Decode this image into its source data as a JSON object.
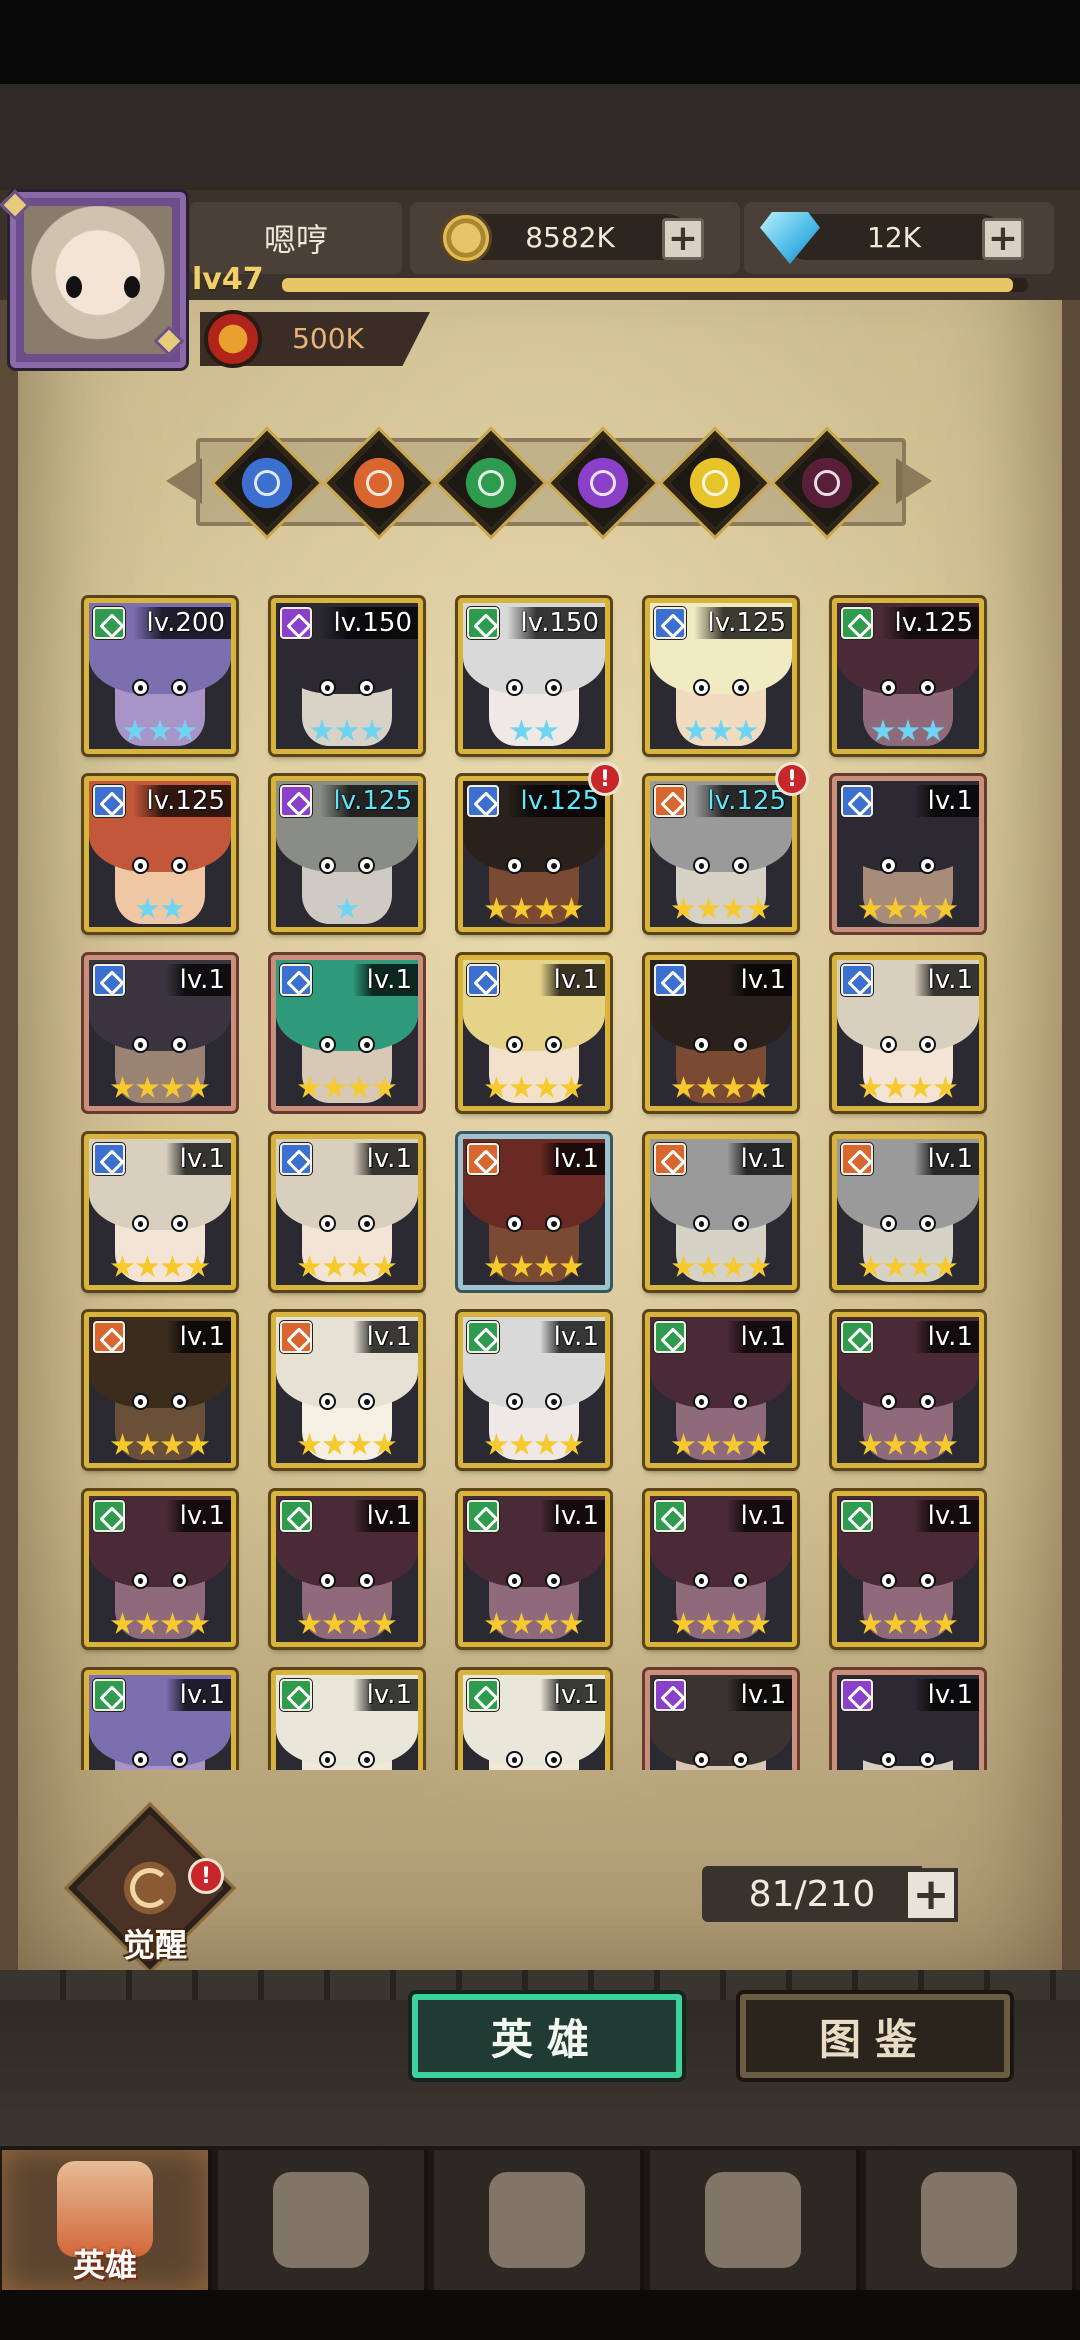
{
  "header": {
    "player_name": "嗯哼",
    "level": "lv47",
    "xp_fraction": 0.98,
    "gold": "8582K",
    "gems": "12K",
    "power": "500K"
  },
  "factions": [
    {
      "name": "faction-light",
      "color": "#3b6fd0"
    },
    {
      "name": "faction-fire",
      "color": "#d8662e"
    },
    {
      "name": "faction-nature",
      "color": "#2f9b4f"
    },
    {
      "name": "faction-arcane",
      "color": "#8a40c8"
    },
    {
      "name": "faction-holy",
      "color": "#e7c42a"
    },
    {
      "name": "faction-dark",
      "color": "#5a1f38"
    }
  ],
  "heroes": [
    {
      "level": "lv.200",
      "class_color": "#2f9b4f",
      "stars": 3,
      "star_color": "blue",
      "hair": "#7b6fb0",
      "skin": "#a994c7",
      "frame": "gold",
      "cyan": false,
      "alert": false
    },
    {
      "level": "lv.150",
      "class_color": "#8a40c8",
      "stars": 3,
      "star_color": "blue",
      "hair": "#2c2933",
      "skin": "#d9d2c6",
      "frame": "gold",
      "cyan": false,
      "alert": false
    },
    {
      "level": "lv.150",
      "class_color": "#2f9b4f",
      "stars": 2,
      "star_color": "blue",
      "hair": "#d9d9d9",
      "skin": "#efe8e4",
      "frame": "gold",
      "cyan": false,
      "alert": false
    },
    {
      "level": "lv.125",
      "class_color": "#3b6fd0",
      "stars": 3,
      "star_color": "blue",
      "hair": "#f1ebc4",
      "skin": "#f1dcc0",
      "frame": "gold",
      "cyan": false,
      "alert": false
    },
    {
      "level": "lv.125",
      "class_color": "#2f9b4f",
      "stars": 3,
      "star_color": "blue",
      "hair": "#4a2a36",
      "skin": "#8e6a7a",
      "frame": "gold",
      "cyan": false,
      "alert": false
    },
    {
      "level": "lv.125",
      "class_color": "#3b6fd0",
      "stars": 2,
      "star_color": "blue",
      "hair": "#c2573a",
      "skin": "#f0c8a6",
      "frame": "gold",
      "cyan": false,
      "alert": false
    },
    {
      "level": "lv.125",
      "class_color": "#8a40c8",
      "stars": 1,
      "star_color": "blue",
      "hair": "#8a8c86",
      "skin": "#cfcbc4",
      "frame": "gold",
      "cyan": true,
      "alert": false
    },
    {
      "level": "lv.125",
      "class_color": "#3b6fd0",
      "stars": 4,
      "star_color": "gold",
      "hair": "#2a211d",
      "skin": "#7a4a32",
      "frame": "gold",
      "cyan": true,
      "alert": true
    },
    {
      "level": "lv.125",
      "class_color": "#d8662e",
      "stars": 4,
      "star_color": "gold",
      "hair": "#9a9a9a",
      "skin": "#d7d2c6",
      "frame": "gold",
      "cyan": true,
      "alert": true
    },
    {
      "level": "lv.1",
      "class_color": "#3b6fd0",
      "stars": 4,
      "star_color": "gold",
      "hair": "#2c2933",
      "skin": "#a78c7a",
      "frame": "pink",
      "cyan": false,
      "alert": false
    },
    {
      "level": "lv.1",
      "class_color": "#3b6fd0",
      "stars": 4,
      "star_color": "gold",
      "hair": "#3a3440",
      "skin": "#9b8374",
      "frame": "pink",
      "cyan": false,
      "alert": false
    },
    {
      "level": "lv.1",
      "class_color": "#3b6fd0",
      "stars": 4,
      "star_color": "gold",
      "hair": "#2f9b7a",
      "skin": "#d7c9b5",
      "frame": "pink",
      "cyan": false,
      "alert": false
    },
    {
      "level": "lv.1",
      "class_color": "#3b6fd0",
      "stars": 4,
      "star_color": "gold",
      "hair": "#e6d38a",
      "skin": "#f2e1cb",
      "frame": "gold",
      "cyan": false,
      "alert": false
    },
    {
      "level": "lv.1",
      "class_color": "#3b6fd0",
      "stars": 4,
      "star_color": "gold",
      "hair": "#2a211d",
      "skin": "#7a4a32",
      "frame": "gold",
      "cyan": false,
      "alert": false
    },
    {
      "level": "lv.1",
      "class_color": "#3b6fd0",
      "stars": 4,
      "star_color": "gold",
      "hair": "#d8cfbe",
      "skin": "#f3e4d6",
      "frame": "gold",
      "cyan": false,
      "alert": false
    },
    {
      "level": "lv.1",
      "class_color": "#3b6fd0",
      "stars": 4,
      "star_color": "gold",
      "hair": "#d8cfbe",
      "skin": "#f3e4d6",
      "frame": "gold",
      "cyan": false,
      "alert": false
    },
    {
      "level": "lv.1",
      "class_color": "#3b6fd0",
      "stars": 4,
      "star_color": "gold",
      "hair": "#d8cfbe",
      "skin": "#f3e4d6",
      "frame": "gold",
      "cyan": false,
      "alert": false
    },
    {
      "level": "lv.1",
      "class_color": "#d8662e",
      "stars": 4,
      "star_color": "gold",
      "hair": "#6a2a24",
      "skin": "#7a4a32",
      "frame": "silver",
      "cyan": false,
      "alert": false
    },
    {
      "level": "lv.1",
      "class_color": "#d8662e",
      "stars": 4,
      "star_color": "gold",
      "hair": "#9a9a9a",
      "skin": "#d7d2c6",
      "frame": "gold",
      "cyan": false,
      "alert": false
    },
    {
      "level": "lv.1",
      "class_color": "#d8662e",
      "stars": 4,
      "star_color": "gold",
      "hair": "#9a9a9a",
      "skin": "#d7d2c6",
      "frame": "gold",
      "cyan": false,
      "alert": false
    },
    {
      "level": "lv.1",
      "class_color": "#d8662e",
      "stars": 4,
      "star_color": "gold",
      "hair": "#3b2c1e",
      "skin": "#6a5038",
      "frame": "gold",
      "cyan": false,
      "alert": false
    },
    {
      "level": "lv.1",
      "class_color": "#d8662e",
      "stars": 4,
      "star_color": "gold",
      "hair": "#e7e1d4",
      "skin": "#f5efe4",
      "frame": "gold",
      "cyan": false,
      "alert": false
    },
    {
      "level": "lv.1",
      "class_color": "#2f9b4f",
      "stars": 4,
      "star_color": "gold",
      "hair": "#d9d9d9",
      "skin": "#efe8e4",
      "frame": "gold",
      "cyan": false,
      "alert": false
    },
    {
      "level": "lv.1",
      "class_color": "#2f9b4f",
      "stars": 4,
      "star_color": "gold",
      "hair": "#4a2a36",
      "skin": "#8e6a7a",
      "frame": "gold",
      "cyan": false,
      "alert": false
    },
    {
      "level": "lv.1",
      "class_color": "#2f9b4f",
      "stars": 4,
      "star_color": "gold",
      "hair": "#4a2a36",
      "skin": "#8e6a7a",
      "frame": "gold",
      "cyan": false,
      "alert": false
    },
    {
      "level": "lv.1",
      "class_color": "#2f9b4f",
      "stars": 4,
      "star_color": "gold",
      "hair": "#4a2a36",
      "skin": "#8e6a7a",
      "frame": "gold",
      "cyan": false,
      "alert": false
    },
    {
      "level": "lv.1",
      "class_color": "#2f9b4f",
      "stars": 4,
      "star_color": "gold",
      "hair": "#4a2a36",
      "skin": "#8e6a7a",
      "frame": "gold",
      "cyan": false,
      "alert": false
    },
    {
      "level": "lv.1",
      "class_color": "#2f9b4f",
      "stars": 4,
      "star_color": "gold",
      "hair": "#4a2a36",
      "skin": "#8e6a7a",
      "frame": "gold",
      "cyan": false,
      "alert": false
    },
    {
      "level": "lv.1",
      "class_color": "#2f9b4f",
      "stars": 4,
      "star_color": "gold",
      "hair": "#4a2a36",
      "skin": "#8e6a7a",
      "frame": "gold",
      "cyan": false,
      "alert": false
    },
    {
      "level": "lv.1",
      "class_color": "#2f9b4f",
      "stars": 4,
      "star_color": "gold",
      "hair": "#4a2a36",
      "skin": "#8e6a7a",
      "frame": "gold",
      "cyan": false,
      "alert": false
    },
    {
      "level": "lv.1",
      "class_color": "#2f9b4f",
      "stars": 0,
      "star_color": "gold",
      "hair": "#7b6fb0",
      "skin": "#a994c7",
      "frame": "gold",
      "cyan": false,
      "alert": false
    },
    {
      "level": "lv.1",
      "class_color": "#2f9b4f",
      "stars": 0,
      "star_color": "gold",
      "hair": "#e9e6da",
      "skin": "#f1e8d8",
      "frame": "gold",
      "cyan": false,
      "alert": false
    },
    {
      "level": "lv.1",
      "class_color": "#2f9b4f",
      "stars": 0,
      "star_color": "gold",
      "hair": "#e9e6da",
      "skin": "#f1e8d8",
      "frame": "gold",
      "cyan": false,
      "alert": false
    },
    {
      "level": "lv.1",
      "class_color": "#8a40c8",
      "stars": 0,
      "star_color": "gold",
      "hair": "#3a3330",
      "skin": "#d9c6b4",
      "frame": "pink",
      "cyan": false,
      "alert": false
    },
    {
      "level": "lv.1",
      "class_color": "#8a40c8",
      "stars": 0,
      "star_color": "gold",
      "hair": "#2c2933",
      "skin": "#d7cfc2",
      "frame": "pink",
      "cyan": false,
      "alert": false
    }
  ],
  "awaken": {
    "label": "觉醒",
    "alert": "!"
  },
  "capacity": "81/210",
  "tabs": {
    "heroes": "英雄",
    "codex": "图鉴"
  },
  "bottom_nav": [
    {
      "name": "nav-heroes",
      "label": "英雄",
      "active": true
    },
    {
      "name": "nav-expedition",
      "label": "",
      "active": false
    },
    {
      "name": "nav-battle",
      "label": "",
      "active": false
    },
    {
      "name": "nav-castle",
      "label": "",
      "active": false
    },
    {
      "name": "nav-guild",
      "label": "",
      "active": false
    }
  ],
  "alert_mark": "!",
  "plus_mark": "+"
}
